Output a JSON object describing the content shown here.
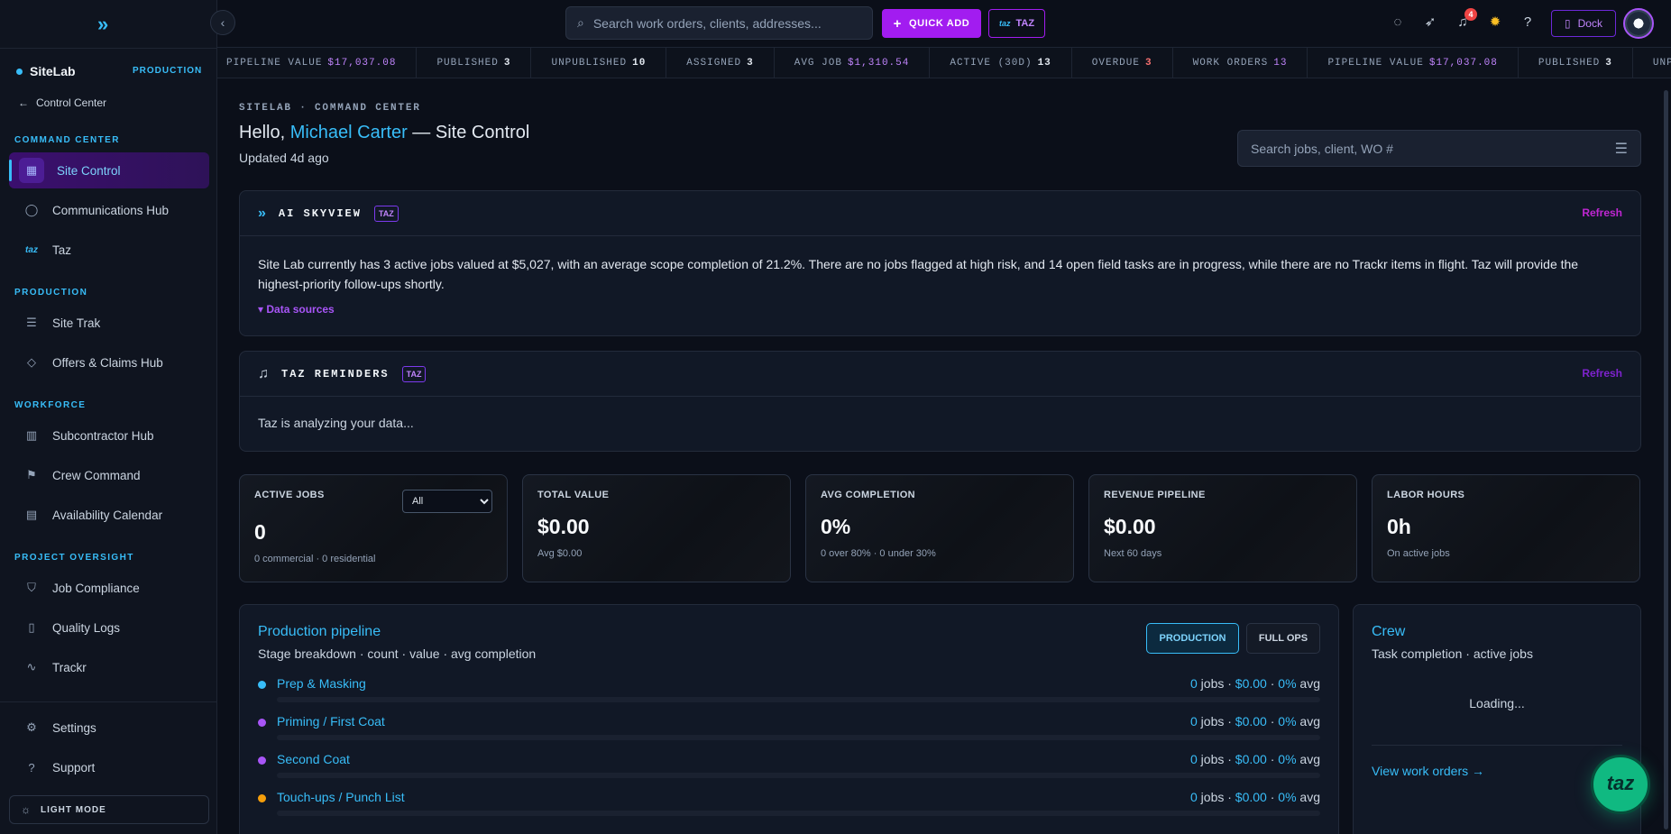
{
  "sidebar": {
    "brand": "SiteLab",
    "env": "PRODUCTION",
    "back_label": "Control Center",
    "sections": {
      "command_center": "COMMAND CENTER",
      "production": "PRODUCTION",
      "workforce": "WORKFORCE",
      "project_oversight": "PROJECT OVERSIGHT"
    },
    "items": {
      "site_control": "Site Control",
      "communications_hub": "Communications Hub",
      "taz": "Taz",
      "site_trak": "Site Trak",
      "offers_claims": "Offers & Claims Hub",
      "subcontractor_hub": "Subcontractor Hub",
      "crew_command": "Crew Command",
      "availability_calendar": "Availability Calendar",
      "job_compliance": "Job Compliance",
      "quality_logs": "Quality Logs",
      "trackr": "Trackr",
      "settings": "Settings",
      "support": "Support"
    },
    "light_mode": "LIGHT MODE"
  },
  "topbar": {
    "search_placeholder": "Search work orders, clients, addresses...",
    "quick_add": "QUICK ADD",
    "taz": "TAZ",
    "notifications_count": "4",
    "dock": "Dock"
  },
  "ticker": [
    {
      "label": "PIPELINE VALUE",
      "value": "$17,037.08",
      "tone": "purple"
    },
    {
      "label": "PUBLISHED",
      "value": "3",
      "tone": "plain"
    },
    {
      "label": "UNPUBLISHED",
      "value": "10",
      "tone": "plain"
    },
    {
      "label": "ASSIGNED",
      "value": "3",
      "tone": "plain"
    },
    {
      "label": "AVG JOB",
      "value": "$1,310.54",
      "tone": "purple"
    },
    {
      "label": "ACTIVE (30D)",
      "value": "13",
      "tone": "plain"
    },
    {
      "label": "OVERDUE",
      "value": "3",
      "tone": "red"
    },
    {
      "label": "WORK ORDERS",
      "value": "13",
      "tone": "purple"
    },
    {
      "label": "PIPELINE VALUE",
      "value": "$17,037.08",
      "tone": "purple"
    },
    {
      "label": "PUBLISHED",
      "value": "3",
      "tone": "plain"
    },
    {
      "label": "UNPUBLISHED",
      "value": "",
      "tone": "plain"
    }
  ],
  "header": {
    "crumb": "SITELAB · COMMAND CENTER",
    "greeting": "Hello, ",
    "user_name": "Michael Carter",
    "title_suffix": " — Site Control",
    "updated": "Updated 4d ago",
    "search_placeholder": "Search jobs, client, WO #"
  },
  "skyview": {
    "title": "AI SKYVIEW",
    "tag": "TAZ",
    "refresh": "Refresh",
    "text": "Site Lab currently has 3 active jobs valued at $5,027, with an average scope completion of 21.2%. There are no jobs flagged at high risk, and 14 open field tasks are in progress, while there are no Trackr items in flight. Taz will provide the highest-priority follow-ups shortly.",
    "sources": "▾ Data sources"
  },
  "reminders": {
    "title": "TAZ REMINDERS",
    "tag": "TAZ",
    "refresh": "Refresh",
    "text": "Taz is analyzing your data..."
  },
  "stats": {
    "active_jobs": {
      "label": "ACTIVE JOBS",
      "value": "0",
      "sub": "0 commercial · 0 residential",
      "filter": "All"
    },
    "total_value": {
      "label": "TOTAL VALUE",
      "value": "$0.00",
      "sub": "Avg $0.00"
    },
    "avg_completion": {
      "label": "AVG COMPLETION",
      "value": "0%",
      "sub": "0 over 80% · 0 under 30%"
    },
    "revenue_pipeline": {
      "label": "REVENUE PIPELINE",
      "value": "$0.00",
      "sub": "Next 60 days"
    },
    "labor_hours": {
      "label": "LABOR HOURS",
      "value": "0h",
      "sub": "On active jobs"
    }
  },
  "pipeline": {
    "title": "Production pipeline",
    "subtitle": "Stage breakdown · count · value · avg completion",
    "tab_production": "PRODUCTION",
    "tab_full_ops": "FULL OPS",
    "stages": [
      {
        "name": "Prep & Masking",
        "jobs": "0",
        "value": "$0.00",
        "pct": "0%",
        "color": "#38bdf8",
        "progress": 0
      },
      {
        "name": "Priming / First Coat",
        "jobs": "0",
        "value": "$0.00",
        "pct": "0%",
        "color": "#a855f7",
        "progress": 0
      },
      {
        "name": "Second Coat",
        "jobs": "0",
        "value": "$0.00",
        "pct": "0%",
        "color": "#a855f7",
        "progress": 0
      },
      {
        "name": "Touch-ups / Punch List",
        "jobs": "0",
        "value": "$0.00",
        "pct": "0%",
        "color": "#f59e0b",
        "progress": 0
      }
    ],
    "jobs_word": " jobs · ",
    "sep": " · ",
    "avg_word": " avg"
  },
  "crew": {
    "title": "Crew",
    "subtitle": "Task completion · active jobs",
    "loading": "Loading...",
    "link": "View work orders →"
  },
  "fab": "taz",
  "colors": {
    "accent": "#38bdf8",
    "brand": "#a21cf0",
    "success": "#10b981",
    "danger": "#ef4444"
  }
}
